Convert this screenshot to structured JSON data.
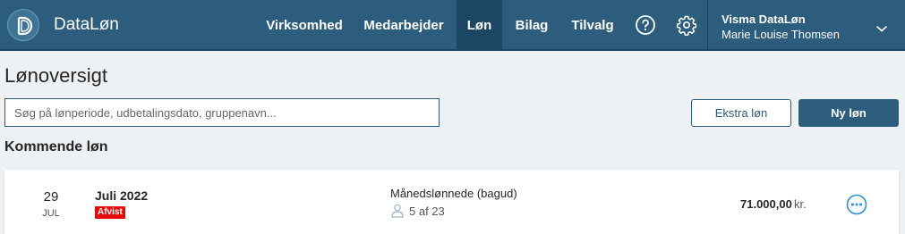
{
  "header": {
    "brand": "DataLøn",
    "nav": [
      {
        "label": "Virksomhed"
      },
      {
        "label": "Medarbejder"
      },
      {
        "label": "Løn",
        "active": true
      },
      {
        "label": "Bilag"
      },
      {
        "label": "Tilvalg"
      }
    ],
    "help_icon": "help-circle-icon",
    "settings_icon": "gear-icon",
    "user": {
      "company": "Visma DataLøn",
      "name": "Marie Louise Thomsen"
    }
  },
  "main": {
    "title": "Lønoversigt",
    "search": {
      "placeholder": "Søg på lønperiode, udbetalingsdato, gruppenavn...",
      "value": ""
    },
    "buttons": {
      "extra": "Ekstra løn",
      "new": "Ny løn"
    },
    "section_title": "Kommende løn",
    "payrolls": [
      {
        "day": "29",
        "month": "JUL",
        "period": "Juli 2022",
        "status": "Afvist",
        "group": "Månedslønnede (bagud)",
        "employees": "5 af 23",
        "amount": "71.000,00",
        "currency": "kr."
      }
    ]
  },
  "colors": {
    "header_bg": "#2c5d7c",
    "nav_active_bg": "#1d4663",
    "page_bg": "#eef1f4",
    "primary_button": "#2c5d7c",
    "status_rejected": "#e70c0c",
    "more_icon": "#2b8fd6"
  }
}
